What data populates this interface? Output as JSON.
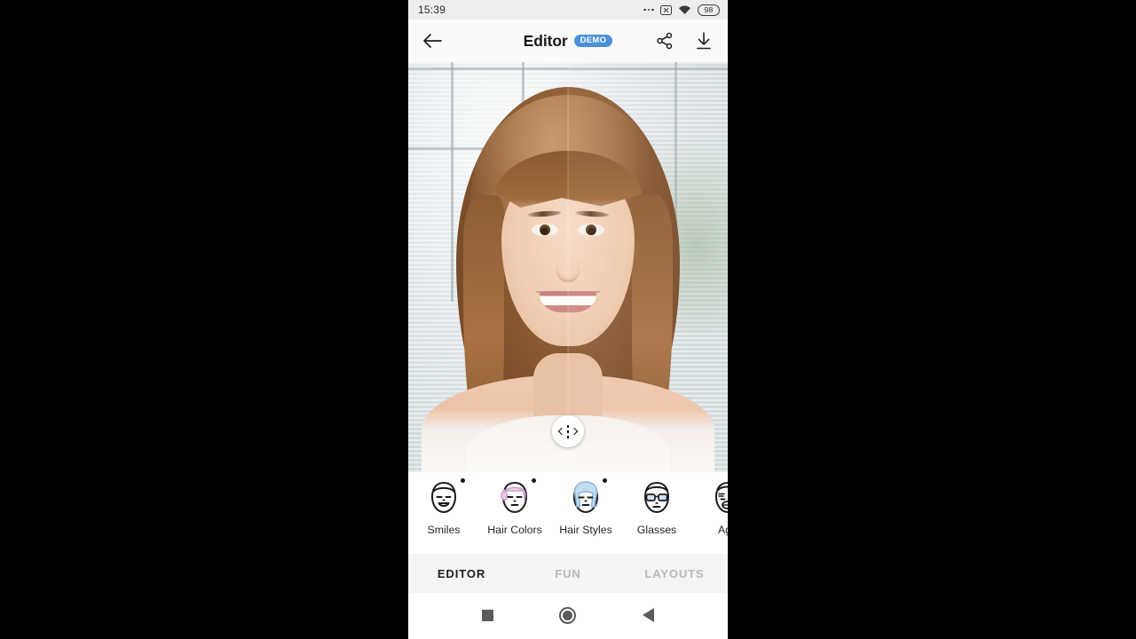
{
  "status_bar": {
    "time": "15:39",
    "battery": "98",
    "icons": [
      "more-dots-icon",
      "x-box-icon",
      "wifi-icon",
      "battery-icon"
    ]
  },
  "app_bar": {
    "back_icon": "back-arrow-icon",
    "title": "Editor",
    "badge": "DEMO",
    "badge_color": "#4a90d9",
    "share_icon": "share-icon",
    "download_icon": "download-icon"
  },
  "photo": {
    "compare_handle": "before-after-compare-handle",
    "alt": "Portrait of a woman with brown hair in front of window blinds, split before/after comparison"
  },
  "tools": [
    {
      "label": "Smiles",
      "icon": "face-smile-icon",
      "badge": true
    },
    {
      "label": "Hair Colors",
      "icon": "face-hair-color-icon",
      "badge": true
    },
    {
      "label": "Hair Styles",
      "icon": "face-hair-style-icon",
      "badge": true
    },
    {
      "label": "Glasses",
      "icon": "face-glasses-icon",
      "badge": false
    },
    {
      "label": "Age",
      "icon": "face-age-icon",
      "badge": false
    }
  ],
  "tabs": [
    {
      "label": "EDITOR",
      "active": true
    },
    {
      "label": "FUN",
      "active": false
    },
    {
      "label": "LAYOUTS",
      "active": false
    }
  ],
  "nav_bar": {
    "recents_icon": "square-recents-icon",
    "home_icon": "circle-home-icon",
    "back_icon": "triangle-back-icon"
  }
}
